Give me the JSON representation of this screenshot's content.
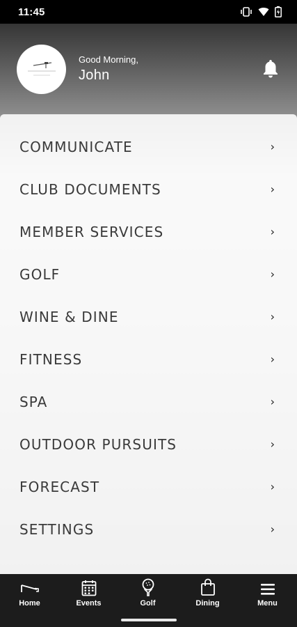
{
  "status_bar": {
    "time": "11:45"
  },
  "header": {
    "greeting": "Good Morning,",
    "user_name": "John",
    "logo_text": "MANCHESTER"
  },
  "menu": {
    "items": [
      {
        "label": "COMMUNICATE"
      },
      {
        "label": "CLUB DOCUMENTS"
      },
      {
        "label": "MEMBER SERVICES"
      },
      {
        "label": "GOLF"
      },
      {
        "label": "WINE & DINE"
      },
      {
        "label": "FITNESS"
      },
      {
        "label": "SPA"
      },
      {
        "label": "OUTDOOR PURSUITS"
      },
      {
        "label": "FORECAST"
      },
      {
        "label": "SETTINGS"
      }
    ],
    "chevron": "›"
  },
  "tabbar": {
    "tabs": [
      {
        "label": "Home",
        "icon": "golf-flag-icon"
      },
      {
        "label": "Events",
        "icon": "calendar-icon"
      },
      {
        "label": "Golf",
        "icon": "golf-ball-tee-icon"
      },
      {
        "label": "Dining",
        "icon": "shopping-bag-icon"
      },
      {
        "label": "Menu",
        "icon": "hamburger-menu-icon"
      }
    ]
  }
}
